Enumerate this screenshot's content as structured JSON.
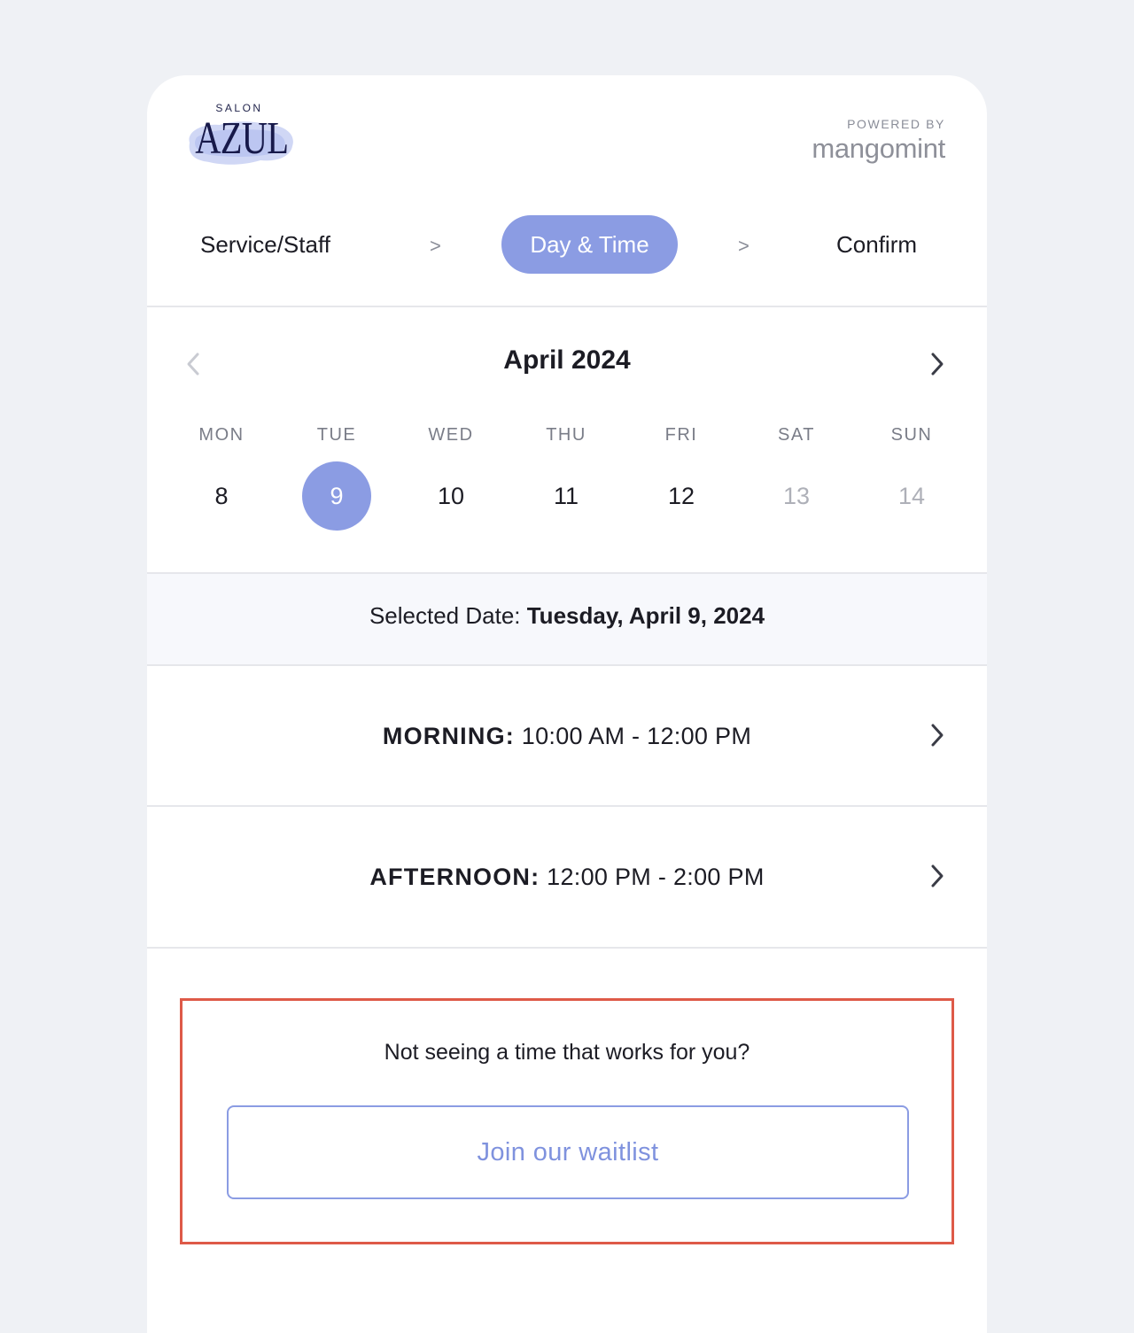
{
  "header": {
    "logo": {
      "small_text": "SALON",
      "big_text": "AZUL"
    },
    "powered_by": {
      "label": "POWERED BY",
      "brand": "mangomint"
    }
  },
  "steps": [
    {
      "label": "Service/Staff",
      "state": "done"
    },
    {
      "label": "Day & Time",
      "state": "active"
    },
    {
      "label": "Confirm",
      "state": "upcoming"
    }
  ],
  "step_separator": ">",
  "calendar": {
    "month_title": "April 2024",
    "prev_icon": "chevron-left-icon",
    "next_icon": "chevron-right-icon",
    "weekdays": [
      "MON",
      "TUE",
      "WED",
      "THU",
      "FRI",
      "SAT",
      "SUN"
    ],
    "days": [
      "8",
      "9",
      "10",
      "11",
      "12",
      "13",
      "14"
    ],
    "selected_day": "9",
    "unavailable_days": [
      "13",
      "14"
    ]
  },
  "selected_date": {
    "label": "Selected Date: ",
    "value": "Tuesday, April 9, 2024"
  },
  "time_slots": [
    {
      "period": "MORNING:",
      "range": " 10:00 AM - 12:00 PM"
    },
    {
      "period": "AFTERNOON:",
      "range": " 12:00 PM - 2:00 PM"
    }
  ],
  "waitlist": {
    "prompt": "Not seeing a time that works for you?",
    "button_label": "Join our waitlist"
  },
  "colors": {
    "accent": "#8b9ce3",
    "highlight_border": "#de5a48",
    "page_background": "#eff1f5"
  }
}
